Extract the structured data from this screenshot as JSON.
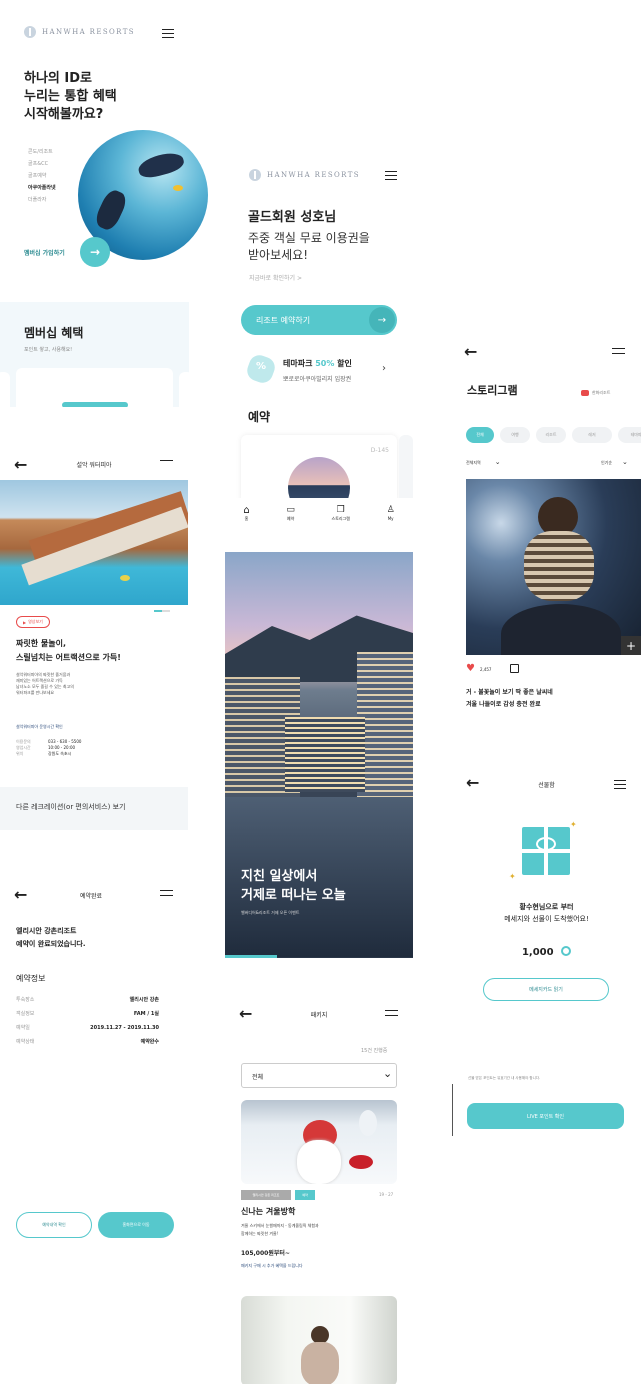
{
  "colors": {
    "teal": "#56c8cc",
    "navy": "#2a4a7a",
    "red": "#e84b4b"
  },
  "s1": {
    "brand": "HANWHA RESORTS",
    "heading": [
      "하나의 ID로",
      "누리는 통합 혜택",
      "시작해볼까요?"
    ],
    "brands": [
      "콘도/리조트",
      "골프&CC",
      "골프예약",
      "아쿠아플라넷",
      "더플라자"
    ],
    "join": "멤버십 가입하기"
  },
  "s2": {
    "title": "멤버십 혜택",
    "sub": "포인트 쌓고, 사용해요!"
  },
  "s3": {
    "brand": "HANWHA RESORTS",
    "greet": "골드회원 성호님",
    "line1": "주중 객실 무료 이용권을",
    "line2": "받아보세요!",
    "check": "지금바로 확인하기 >",
    "cta": "리조트 예약하기",
    "promo_title_a": "테마파크 ",
    "promo_pct": "50%",
    "promo_title_b": " 할인",
    "promo_sub": "뽀로로아쿠아빌리지 입장권",
    "section": "예약",
    "dday": "D-145",
    "nav": [
      "홈",
      "예약",
      "스토리그램",
      "My"
    ]
  },
  "s4": {
    "caption1": "지친 일상에서",
    "caption2": "거제로 떠나는 오늘",
    "small": "벨버디어&리조트 거제 오픈 이벤트"
  },
  "s5": {
    "title": "설악 워터피아",
    "badge": "영상보기",
    "h1": "짜릿한 물놀이,",
    "h2": "스릴넘치는 어트랙션으로 가득!",
    "desc": [
      "설악워터피아의 짜릿한 즐거움과",
      "재미있는 어트랙션으로 가득",
      "남녀노소 모두 즐길 수 있는 최고의",
      "워터파크를 만나보세요"
    ],
    "link": "설악워터피아 운영시간 확인",
    "rows": [
      [
        "이용문의",
        "033 - 630 - 5500"
      ],
      [
        "영업시간",
        "10:00 - 20:00"
      ],
      [
        "위치",
        "강원도 속초시"
      ]
    ],
    "more": "다른 레크레이션(or 편의서비스) 보기"
  },
  "s6": {
    "title": "스토리그램",
    "chip": "한화리조트",
    "tabs": [
      "전체",
      "여행",
      "리조트",
      "레저",
      "테마파크"
    ],
    "filterA": "전체지역",
    "filterB": "인기순",
    "likes": "2,457",
    "text1": "거 - 불꽃놀이 보기 딱 좋은 날씨네",
    "text2": "겨울 나들이로 감성 충전 완료"
  },
  "s7": {
    "title": "예약완료",
    "msg1": "엘리시안 강촌리조트",
    "msg2": "예약이 완료되었습니다.",
    "section": "예약정보",
    "rows": [
      [
        "투숙장소",
        "엘리시안 강촌"
      ],
      [
        "객실정보",
        "FAM / 1실"
      ],
      [
        "예약일",
        "2019.11.27 - 2019.11.30"
      ],
      [
        "예약상태",
        "예약완수"
      ]
    ],
    "btnA": "예약내역 확인",
    "btnB": "홈화면으로 이동"
  },
  "s8": {
    "title": "패키지",
    "count": "15건 진행중",
    "select": "전체",
    "tagA": "엘리시안 강촌 리조트",
    "tagB": "예약",
    "date": "19 - 27",
    "name": "신나는 겨울방학",
    "desc1": "겨울 스키에서 눈썰매까지 - 동계올림픽 체험과",
    "desc2": "함께하는 짜릿한 겨울!",
    "price": "105,000원부터~",
    "link": "패키지 구매 시 추가 혜택을 드립니다"
  },
  "s9": {
    "title": "선물함",
    "msg1": "황수현님으로 부터",
    "msg2": "메세지와 선물이 도착했어요!",
    "amount": "1,000",
    "btn": "메세지카드 읽기",
    "note": "선물 받은 포인트는 유효기간 내 사용해야 합니다.",
    "live": "LIVE 포인트 확인"
  }
}
